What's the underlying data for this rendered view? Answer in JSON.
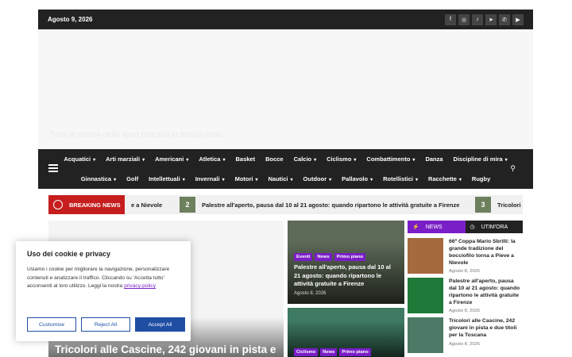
{
  "topbar": {
    "date": "Agosto 9, 2026",
    "social_icons": [
      "f",
      "◎",
      "♪",
      "➤",
      "✆",
      "▶"
    ]
  },
  "header": {
    "tagline": "Tutte le notizie dello sport toscano in tempo reale"
  },
  "nav": {
    "row1": [
      {
        "label": "Acquatici",
        "dropdown": true
      },
      {
        "label": "Arti marziali",
        "dropdown": true
      },
      {
        "label": "Americani",
        "dropdown": true
      },
      {
        "label": "Atletica",
        "dropdown": true
      },
      {
        "label": "Basket",
        "dropdown": false
      },
      {
        "label": "Bocce",
        "dropdown": false
      },
      {
        "label": "Calcio",
        "dropdown": true
      },
      {
        "label": "Ciclismo",
        "dropdown": true
      },
      {
        "label": "Combattimento",
        "dropdown": true
      },
      {
        "label": "Danza",
        "dropdown": false
      },
      {
        "label": "Discipline di mira",
        "dropdown": true
      }
    ],
    "row2": [
      {
        "label": "Ginnastica",
        "dropdown": true
      },
      {
        "label": "Golf",
        "dropdown": false
      },
      {
        "label": "Intellettuali",
        "dropdown": true
      },
      {
        "label": "Invernali",
        "dropdown": true
      },
      {
        "label": "Motori",
        "dropdown": true
      },
      {
        "label": "Nautici",
        "dropdown": true
      },
      {
        "label": "Outdoor",
        "dropdown": true
      },
      {
        "label": "Pallavolo",
        "dropdown": true
      },
      {
        "label": "Rotellistici",
        "dropdown": true
      },
      {
        "label": "Racchette",
        "dropdown": true
      },
      {
        "label": "Rugby",
        "dropdown": false
      }
    ]
  },
  "breaking": {
    "label": "BREAKING NEWS",
    "fragment": "e a Nievole",
    "items": [
      {
        "num": "2",
        "text": "Palestre all'aperto, pausa dal 10 al 21 agosto: quando ripartono le attività gratuite a Firenze"
      },
      {
        "num": "3",
        "text": "Tricolori a"
      }
    ]
  },
  "main": {
    "title": "Tricolori alle Cascine, 242 giovani in pista e"
  },
  "cards": [
    {
      "tags": [
        "Eventi",
        "News",
        "Primo piano"
      ],
      "title": "Palestre all'aperto, pausa dal 10 al 21 agosto: quando ripartono le attività gratuite a Firenze",
      "date": "Agosto 8, 2026"
    },
    {
      "tags": [
        "Ciclismo",
        "News",
        "Primo piano"
      ],
      "title": "",
      "date": ""
    }
  ],
  "sidebar": {
    "tabs": [
      "NEWS",
      "UTIM'ORA"
    ],
    "items": [
      {
        "text": "66ª Coppa Mario Sbrilli: la grande tradizione del bocciofilo torna a Pieve a Nievole",
        "date": "Agosto 8, 2026"
      },
      {
        "text": "Palestre all'aperto, pausa dal 10 al 21 agosto: quando ripartono le attività gratuite a Firenze",
        "date": "Agosto 8, 2026"
      },
      {
        "text": "Tricolori alle Cascine, 242 giovani in pista e due titoli per la Toscana",
        "date": "Agosto 8, 2026"
      }
    ]
  },
  "cookie": {
    "title": "Uso dei cookie e privacy",
    "body": "Usiamo i cookie per migliorare la navigazione, personalizzare contenuti e analizzare il traffico. Cliccando su 'Accetta tutto' acconsenti al loro utilizzo. Leggi la nostra",
    "link": "privacy-policy",
    "customise": "Customise",
    "reject": "Reject All",
    "accept": "Accept All"
  },
  "colors": {
    "accent": "#7a1ec7",
    "breaking": "#c61e1e",
    "dark": "#222222",
    "button": "#1f4ea3"
  }
}
